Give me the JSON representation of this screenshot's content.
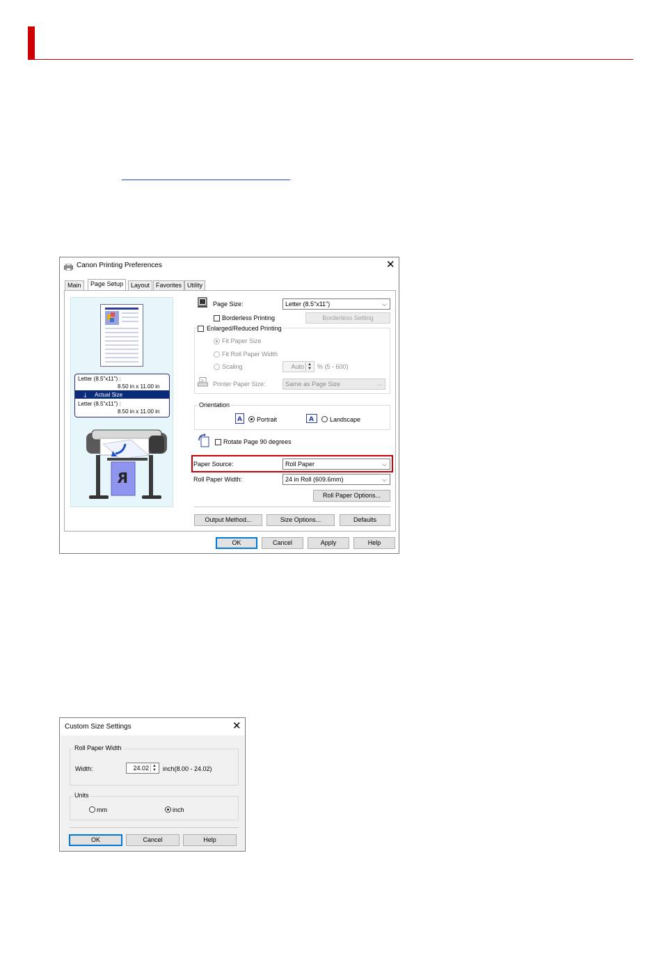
{
  "prefs_dialog": {
    "title": "Canon Printing Preferences",
    "close_glyph": "✕",
    "tabs": [
      "Main",
      "Page Setup",
      "Layout",
      "Favorites",
      "Utility"
    ],
    "preview": {
      "size_top": "Letter (8.5\"x11\") :",
      "size_top_dims": "8.50 in x 11.00 in",
      "actual": "Actual Size",
      "size_bottom": "Letter (8.5\"x11\") :",
      "size_bottom_dims": "8.50 in x 11.00 in"
    },
    "page_size_label": "Page Size:",
    "page_size_value": "Letter (8.5\"x11\")",
    "borderless_label": "Borderless Printing",
    "borderless_setting_btn": "Borderless Setting",
    "enlarged_label": "Enlarged/Reduced Printing",
    "fit_paper_size": "Fit Paper Size",
    "fit_roll_width": "Fit Roll Paper Width",
    "scaling_label": "Scaling",
    "scaling_value": "Auto",
    "scaling_range": "% (5 - 600)",
    "printer_paper_size_label": "Printer Paper Size:",
    "printer_paper_size_value": "Same as Page Size",
    "orientation_label": "Orientation",
    "portrait_label": "Portrait",
    "landscape_label": "Landscape",
    "rotate_label": "Rotate Page 90 degrees",
    "paper_source_label": "Paper Source:",
    "paper_source_value": "Roll Paper",
    "roll_width_label": "Roll Paper Width:",
    "roll_width_value": "24 in Roll (609.6mm)",
    "roll_options_btn": "Roll Paper Options...",
    "output_method_btn": "Output Method...",
    "size_options_btn": "Size Options...",
    "defaults_btn": "Defaults",
    "ok_btn": "OK",
    "cancel_btn": "Cancel",
    "apply_btn": "Apply",
    "help_btn": "Help",
    "highlight_color": "#cc0000"
  },
  "custom_dialog": {
    "title": "Custom Size Settings",
    "close_glyph": "✕",
    "group_roll": "Roll Paper Width",
    "width_label": "Width:",
    "width_value": "24.02",
    "width_range": "inch(8.00 - 24.02)",
    "group_units": "Units",
    "unit_mm": "mm",
    "unit_inch": "inch",
    "ok_btn": "OK",
    "cancel_btn": "Cancel",
    "help_btn": "Help"
  },
  "colors": {
    "accent_red": "#cc0000",
    "link_blue": "#1a4fd0",
    "selection_navy": "#0a2a7a",
    "preview_bg": "#e6f6fb"
  }
}
